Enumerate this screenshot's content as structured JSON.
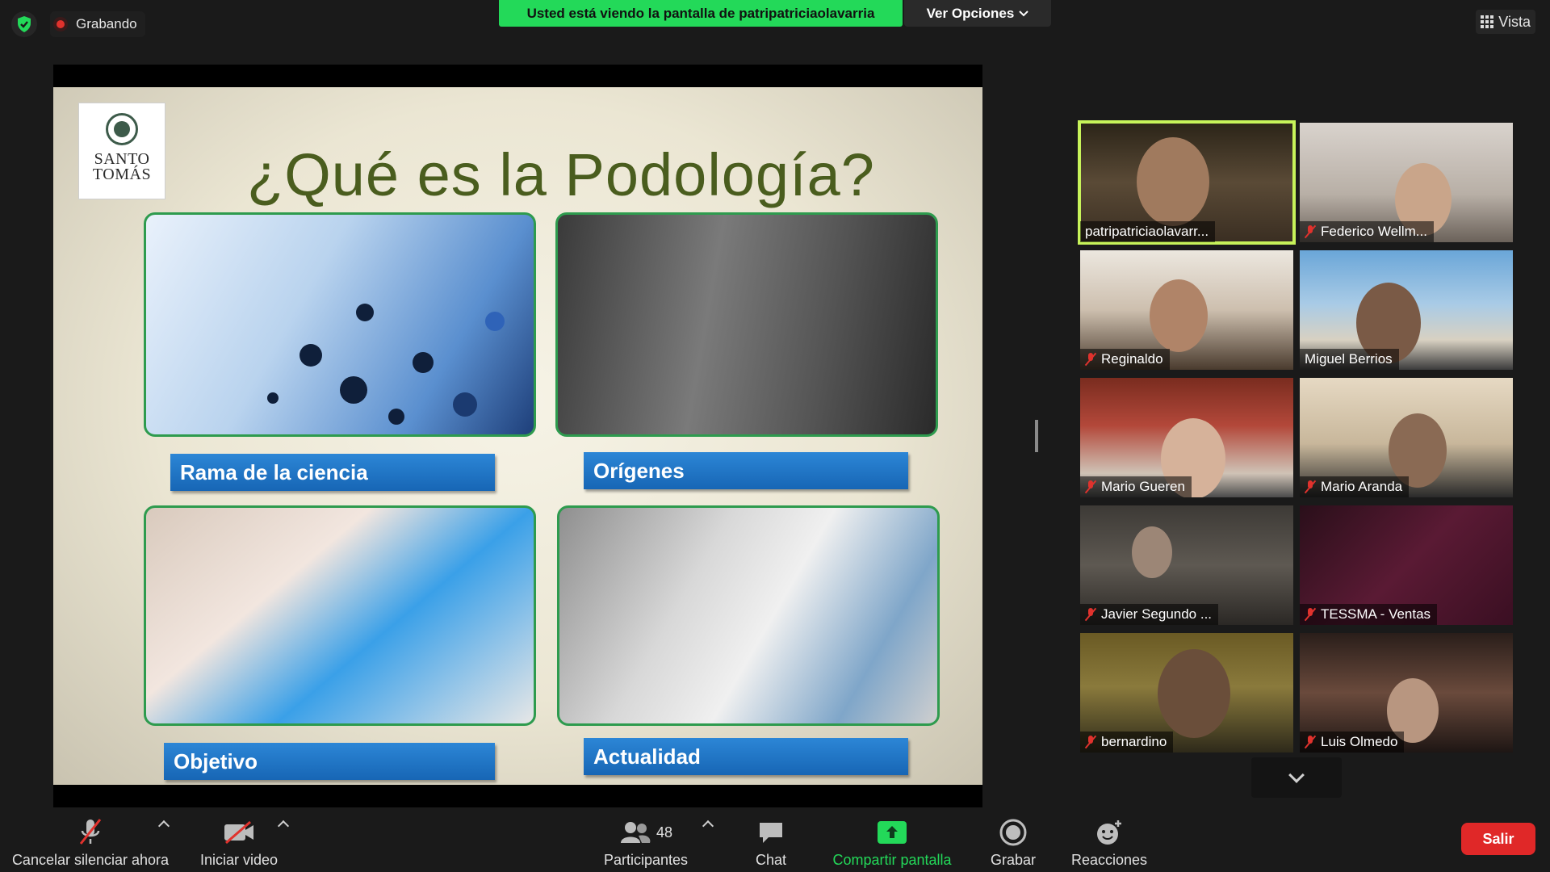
{
  "top": {
    "recording_label": "Grabando",
    "share_banner": "Usted está viendo la pantalla de patripatriciaolavarria",
    "view_options_label": "Ver Opciones",
    "view_label": "Vista"
  },
  "slide": {
    "logo_line1": "SANTO",
    "logo_line2": "TOMÁS",
    "title": "¿Qué es la Podología?",
    "labels": [
      "Rama de la ciencia",
      "Orígenes",
      "Objetivo",
      "Actualidad"
    ]
  },
  "participants": [
    {
      "name": "patripatriciaolavarr...",
      "muted": false,
      "active": true
    },
    {
      "name": "Federico Wellm...",
      "muted": true
    },
    {
      "name": "Reginaldo",
      "muted": true
    },
    {
      "name": "Miguel Berrios",
      "muted": false
    },
    {
      "name": "Mario Gueren",
      "muted": true
    },
    {
      "name": "Mario Aranda",
      "muted": true
    },
    {
      "name": "Javier Segundo ...",
      "muted": true
    },
    {
      "name": "TESSMA - Ventas",
      "muted": true
    },
    {
      "name": "bernardino",
      "muted": true
    },
    {
      "name": "Luis Olmedo",
      "muted": true
    }
  ],
  "toolbar": {
    "unmute_label": "Cancelar silenciar ahora",
    "video_label": "Iniciar video",
    "participants_label": "Participantes",
    "participants_count": "48",
    "chat_label": "Chat",
    "share_label": "Compartir pantalla",
    "record_label": "Grabar",
    "reactions_label": "Reacciones",
    "leave_label": "Salir"
  },
  "colors": {
    "accent_green": "#23d959",
    "active_speaker": "#c7f35a",
    "leave_red": "#e02828",
    "slide_title": "#4a5d1e",
    "label_blue": "#1766b5"
  },
  "icons": [
    "shield-check-icon",
    "record-dot-icon",
    "chevron-down-icon",
    "grid-icon",
    "mic-muted-icon",
    "video-off-icon",
    "participants-icon",
    "chat-icon",
    "share-screen-icon",
    "record-icon",
    "reactions-icon"
  ]
}
